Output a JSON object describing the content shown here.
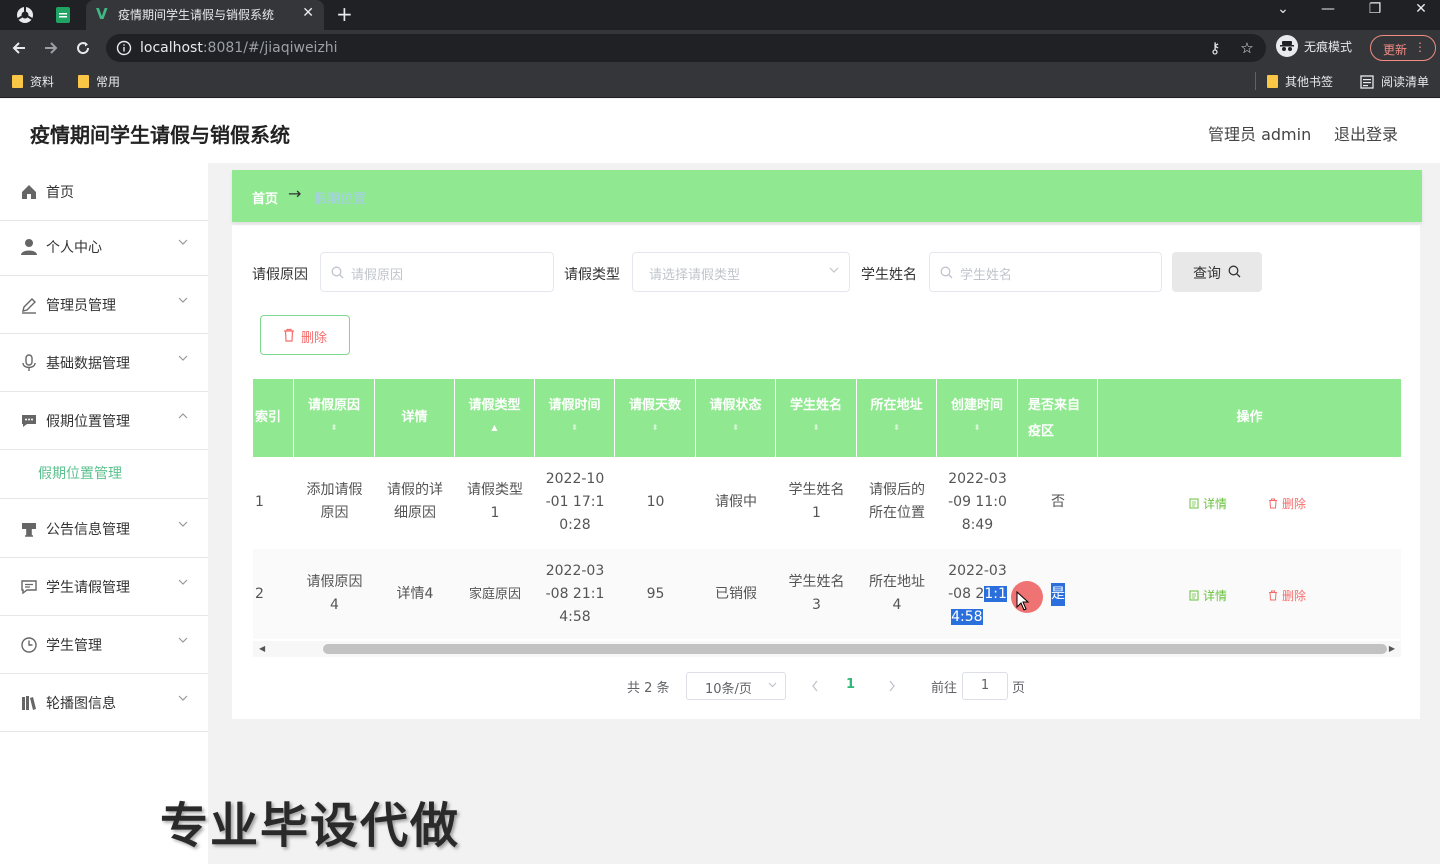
{
  "browser": {
    "tab_title": "疫情期间学生请假与销假系统",
    "url_host": "localhost",
    "url_rest": ":8081/#/jiaqiweizhi",
    "incognito_label": "无痕模式",
    "update_label": "更新",
    "bookmarks": [
      "资料",
      "常用"
    ],
    "other_bookmarks": "其他书签",
    "reading_list": "阅读清单"
  },
  "header": {
    "title": "疫情期间学生请假与销假系统",
    "user_label": "管理员 admin",
    "logout": "退出登录"
  },
  "sidebar": {
    "items": [
      {
        "label": "首页",
        "icon": "home-icon"
      },
      {
        "label": "个人中心",
        "icon": "user-icon"
      },
      {
        "label": "管理员管理",
        "icon": "edit-icon"
      },
      {
        "label": "基础数据管理",
        "icon": "microphone-icon"
      },
      {
        "label": "假期位置管理",
        "icon": "chat-icon"
      },
      {
        "label": "公告信息管理",
        "icon": "podium-icon"
      },
      {
        "label": "学生请假管理",
        "icon": "message-icon"
      },
      {
        "label": "学生管理",
        "icon": "clock-icon"
      },
      {
        "label": "轮播图信息",
        "icon": "books-icon"
      }
    ],
    "active_sub": "假期位置管理"
  },
  "breadcrumb": {
    "home": "首页",
    "arrow": "→",
    "current": "假期位置"
  },
  "filters": {
    "reason_label": "请假原因",
    "reason_placeholder": "请假原因",
    "type_label": "请假类型",
    "type_placeholder": "请选择请假类型",
    "name_label": "学生姓名",
    "name_placeholder": "学生姓名",
    "query_label": "查询"
  },
  "actions": {
    "delete_label": "删除"
  },
  "table": {
    "headers": [
      "索引",
      "请假原因",
      "详情",
      "请假类型",
      "请假时间",
      "请假天数",
      "请假状态",
      "学生姓名",
      "所在地址",
      "创建时间",
      "是否来自疫区",
      "操作"
    ],
    "rows": [
      {
        "index": "1",
        "reason": [
          "添加请假",
          "原因"
        ],
        "detail": [
          "请假的详",
          "细原因"
        ],
        "type": [
          "请假类型",
          "1"
        ],
        "time": [
          "2022-10",
          "-01 17:1",
          "0:28"
        ],
        "days": "10",
        "status": "请假中",
        "name": [
          "学生姓名",
          "1"
        ],
        "address": [
          "请假后的",
          "所在位置"
        ],
        "created": [
          "2022-03",
          "-09 11:0",
          "8:49"
        ],
        "epidemic": "否"
      },
      {
        "index": "2",
        "reason": [
          "请假原因",
          "4"
        ],
        "detail": [
          "详情4"
        ],
        "type": [
          "家庭原因"
        ],
        "time": [
          "2022-03",
          "-08 21:1",
          "4:58"
        ],
        "days": "95",
        "status": "已销假",
        "name": [
          "学生姓名",
          "3"
        ],
        "address": [
          "所在地址",
          "4"
        ],
        "created_a": "2022-03",
        "created_b1": "-08 2",
        "created_b2": "1:1",
        "created_c": "4:58",
        "epidemic": "是"
      }
    ],
    "op_detail": "详情",
    "op_delete": "删除"
  },
  "pagination": {
    "total": "共 2 条",
    "page_size": "10条/页",
    "current": "1",
    "goto_label": "前往",
    "goto_value": "1",
    "page_suffix": "页"
  },
  "watermark": "专业毕设代做",
  "colors": {
    "accent_green": "#90e990",
    "link_green": "#2fb978",
    "danger": "#f56c6c"
  }
}
